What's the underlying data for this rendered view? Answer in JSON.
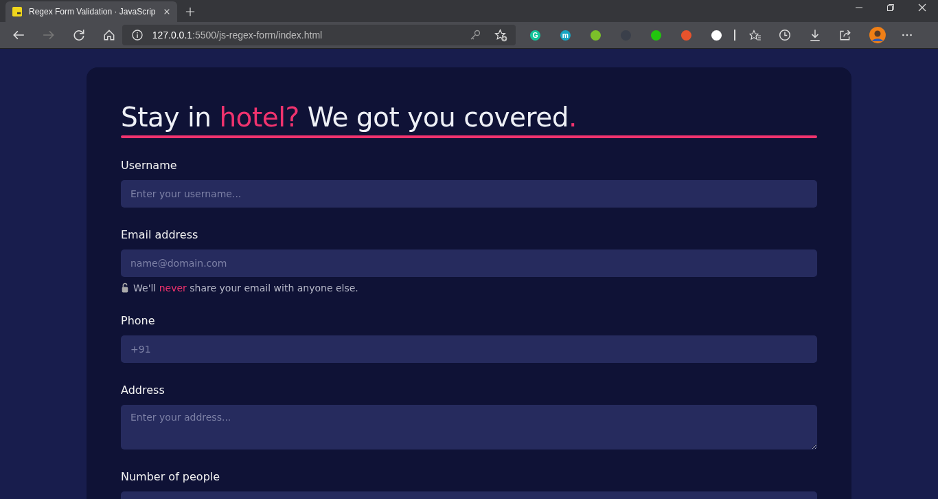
{
  "browser": {
    "tab": {
      "title": "Regex Form Validation · JavaScrip",
      "selected": true
    },
    "address": {
      "host": "127.0.0.1",
      "path": ":5500/js-regex-form/index.html"
    },
    "extensions": [
      {
        "color": "#15c39a",
        "letter": "G"
      },
      {
        "color": "#17a5c2",
        "letter": "m"
      },
      {
        "color": "#7cbf2a"
      },
      {
        "color": "#3a3f4a"
      },
      {
        "color": "#22c40e"
      },
      {
        "color": "#e8532c"
      },
      {
        "color": "#ffffff"
      }
    ]
  },
  "heading": [
    {
      "text": "Stay in ",
      "accent": false
    },
    {
      "text": "hotel?",
      "accent": true
    },
    {
      "text": " We got you covered",
      "accent": false
    },
    {
      "text": ".",
      "accent": true
    }
  ],
  "fields": [
    {
      "label": "Username",
      "kind": "input",
      "placeholder": "Enter your username..."
    },
    {
      "label": "Email address",
      "kind": "input",
      "placeholder": "name@domain.com",
      "hint": [
        {
          "text": "We'll ",
          "accent": false
        },
        {
          "text": "never",
          "accent": true
        },
        {
          "text": " share your email with anyone else.",
          "accent": false
        }
      ]
    },
    {
      "label": "Phone",
      "kind": "input",
      "placeholder": "+91"
    },
    {
      "label": "Address",
      "kind": "textarea",
      "placeholder": "Enter your address..."
    },
    {
      "label": "Number of people",
      "kind": "input"
    }
  ]
}
